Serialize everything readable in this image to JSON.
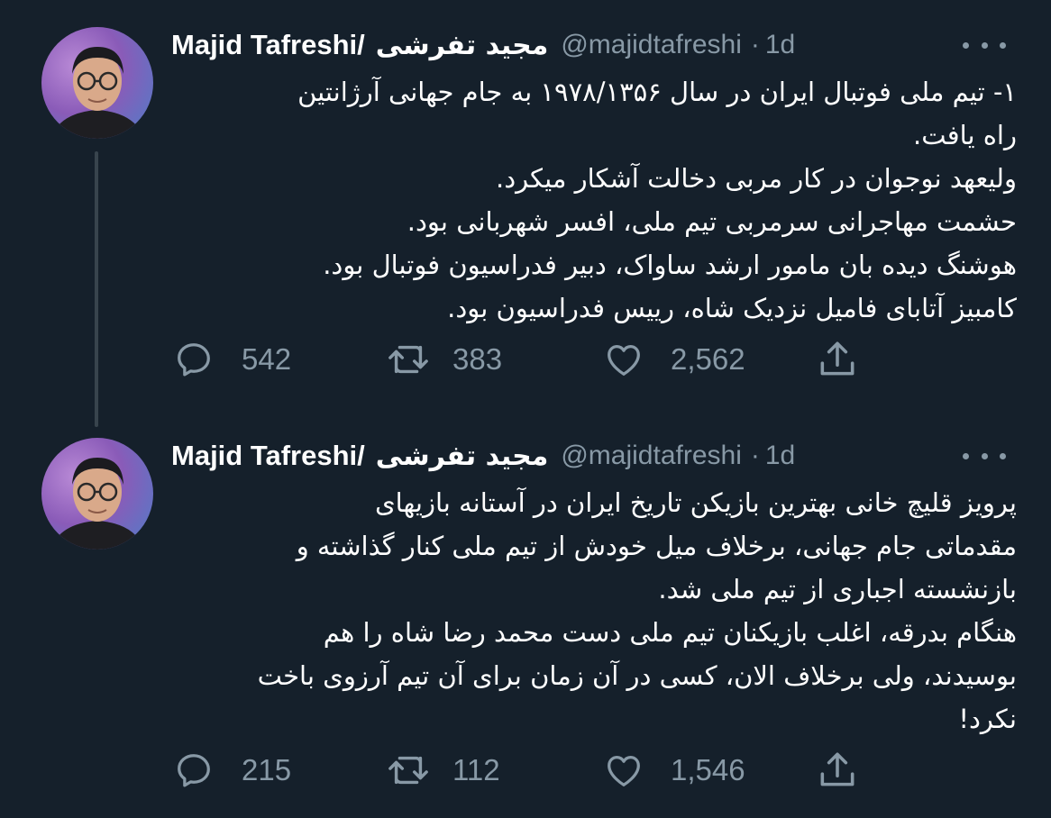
{
  "tweets": [
    {
      "display_name": "Majid Tafreshi/",
      "display_name_fa": "مجید تفرشی",
      "handle": "@majidtafreshi",
      "separator": "·",
      "time": "1d",
      "more_icon": "more-horizontal-icon",
      "lines": [
        "۱- تیم ملی فوتبال ایران در سال ۱۹۷۸/۱۳۵۶ به جام جهانی آرژانتین",
        "راه یافت.",
        "ولیعهد نوجوان در کار مربی دخالت آشکار میکرد.",
        "حشمت مهاجرانی سرمربی تیم ملی، افسر شهربانی بود.",
        "هوشنگ دیده بان مامور ارشد ساواک، دبیر فدراسیون فوتبال بود.",
        "کامبیز آتابای فامیل نزدیک شاه، رییس فدراسیون بود."
      ],
      "reply_count": "542",
      "retweet_count": "383",
      "like_count": "2,562"
    },
    {
      "display_name": "Majid Tafreshi/",
      "display_name_fa": "مجید تفرشی",
      "handle": "@majidtafreshi",
      "separator": "·",
      "time": "1d",
      "more_icon": "more-horizontal-icon",
      "lines": [
        "پرویز قلیچ خانی بهترین بازیکن تاریخ ایران در آستانه بازیهای",
        "مقدماتی جام جهانی، برخلاف میل خودش از تیم ملی کنار گذاشته و",
        "بازنشسته اجباری از تیم ملی شد.",
        "هنگام بدرقه، اغلب بازیکنان تیم ملی دست محمد رضا شاه را هم",
        "بوسیدند، ولی برخلاف الان، کسی در آن زمان برای آن تیم آرزوی باخت",
        "نکرد!"
      ],
      "reply_count": "215",
      "retweet_count": "112",
      "like_count": "1,546"
    }
  ],
  "colors": {
    "background": "#15202b",
    "text": "#ffffff",
    "muted": "#8899a6",
    "thread_line": "#38444d"
  }
}
